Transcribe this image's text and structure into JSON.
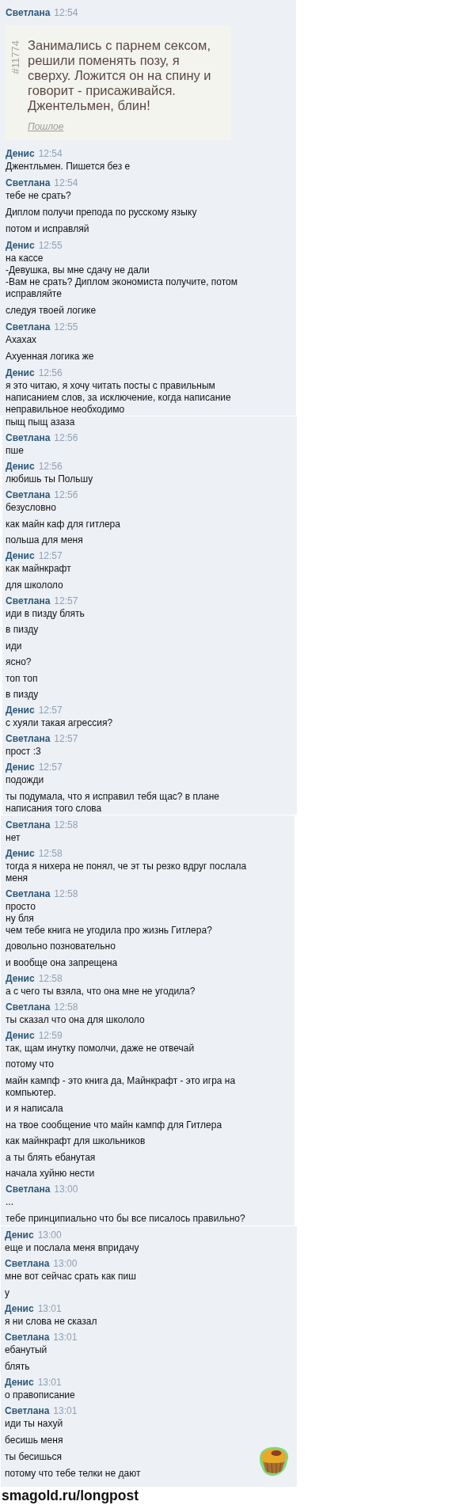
{
  "chat": {
    "segments": [
      {
        "items": [
          {
            "kind": "header",
            "sender": "Светлана",
            "time": "12:54"
          },
          {
            "kind": "quote",
            "number": "#11774",
            "text": "Занимались с парнем сексом,\nрешили поменять позу, я\nсверху. Ложится он на спину и\nговорит - присаживайся.\nДжентельмен, блин!",
            "tag": "Пошлое"
          },
          {
            "kind": "header",
            "sender": "Денис",
            "time": "12:54"
          },
          {
            "kind": "message",
            "text": "Джентльмен. Пишется без е"
          },
          {
            "kind": "header",
            "sender": "Светлана",
            "time": "12:54"
          },
          {
            "kind": "message",
            "text": "тебе не срать?"
          },
          {
            "kind": "message",
            "text": "Диплом получи препода по русскому языку"
          },
          {
            "kind": "message",
            "text": "потом и исправляй"
          },
          {
            "kind": "header",
            "sender": "Денис",
            "time": "12:55"
          },
          {
            "kind": "message",
            "text": "на кассе\n-Девушка, вы мне сдачу не дали\n-Вам не срать? Диплом экономиста получите, потом\nисправляйте"
          },
          {
            "kind": "message",
            "text": "следуя твоей логике"
          },
          {
            "kind": "header",
            "sender": "Светлана",
            "time": "12:55"
          },
          {
            "kind": "message",
            "text": "Ахахах"
          },
          {
            "kind": "message",
            "text": "Ахуенная логика же"
          },
          {
            "kind": "header",
            "sender": "Денис",
            "time": "12:56"
          },
          {
            "kind": "message",
            "text": "я это читаю, я хочу читать посты с правильным\nнаписанием слов, за исключение, когда написание\nнеправильное необходимо"
          }
        ]
      },
      {
        "items": [
          {
            "kind": "message",
            "text": "пыщ пыщ азаза"
          },
          {
            "kind": "header",
            "sender": "Светлана",
            "time": "12:56"
          },
          {
            "kind": "message",
            "text": "пше"
          },
          {
            "kind": "header",
            "sender": "Денис",
            "time": "12:56"
          },
          {
            "kind": "message",
            "text": "любишь ты Польшу"
          },
          {
            "kind": "header",
            "sender": "Светлана",
            "time": "12:56"
          },
          {
            "kind": "message",
            "text": "безусловно"
          },
          {
            "kind": "message",
            "text": "как майн каф для гитлера"
          },
          {
            "kind": "message",
            "text": "польша для меня"
          },
          {
            "kind": "header",
            "sender": "Денис",
            "time": "12:57"
          },
          {
            "kind": "message",
            "text": "как майнкрафт"
          },
          {
            "kind": "message",
            "text": "для школоло"
          },
          {
            "kind": "header",
            "sender": "Светлана",
            "time": "12:57"
          },
          {
            "kind": "message",
            "text": "иди в пизду блять"
          },
          {
            "kind": "message",
            "text": "в пизду"
          },
          {
            "kind": "message",
            "text": "иди"
          },
          {
            "kind": "message",
            "text": "ясно?"
          },
          {
            "kind": "message",
            "text": "топ топ"
          },
          {
            "kind": "message",
            "text": "в пизду"
          },
          {
            "kind": "header",
            "sender": "Денис",
            "time": "12:57"
          },
          {
            "kind": "message",
            "text": "с хуяли такая агрессия?"
          },
          {
            "kind": "header",
            "sender": "Светлана",
            "time": "12:57"
          },
          {
            "kind": "message",
            "text": "прост :3"
          },
          {
            "kind": "header",
            "sender": "Денис",
            "time": "12:57"
          },
          {
            "kind": "message",
            "text": "подожди"
          },
          {
            "kind": "message",
            "text": "ты подумала, что я исправил тебя щас? в плане\nнаписания того слова"
          }
        ]
      },
      {
        "items": [
          {
            "kind": "header",
            "sender": "Светлана",
            "time": "12:58"
          },
          {
            "kind": "message",
            "text": "нет"
          },
          {
            "kind": "header",
            "sender": "Денис",
            "time": "12:58"
          },
          {
            "kind": "message",
            "text": "тогда я нихера не понял, че эт ты резко вдруг послала\nменя"
          },
          {
            "kind": "header",
            "sender": "Светлана",
            "time": "12:58"
          },
          {
            "kind": "message",
            "text": "просто\nну бля\nчем тебе книга не угодила про жизнь Гитлера?"
          },
          {
            "kind": "message",
            "text": "довольно позновательно"
          },
          {
            "kind": "message",
            "text": "и вообще она запрещена"
          },
          {
            "kind": "header",
            "sender": "Денис",
            "time": "12:58"
          },
          {
            "kind": "message",
            "text": "а с чего ты взяла, что она мне не угодила?"
          },
          {
            "kind": "header",
            "sender": "Светлана",
            "time": "12:58"
          },
          {
            "kind": "message",
            "text": "ты сказал что она для школоло"
          },
          {
            "kind": "header",
            "sender": "Денис",
            "time": "12:59"
          },
          {
            "kind": "message",
            "text": "так, щам инутку помолчи, даже не отвечай"
          },
          {
            "kind": "message",
            "text": "потому что"
          },
          {
            "kind": "message",
            "text": "майн кампф - это книга да, Майнкрафт - это игра на\nкомпьютер."
          },
          {
            "kind": "message",
            "text": "и я написала"
          },
          {
            "kind": "message",
            "text": "на твое сообщение что майн кампф для Гитлера"
          },
          {
            "kind": "message",
            "text": "как майнкрафт для школьников"
          },
          {
            "kind": "message",
            "text": "а ты блять ебанутая"
          },
          {
            "kind": "message",
            "text": "начала хуйню нести"
          },
          {
            "kind": "header",
            "sender": "Светлана",
            "time": "13:00"
          },
          {
            "kind": "message",
            "text": "..."
          },
          {
            "kind": "message",
            "text": "тебе принципиально что бы все писалось правильно?"
          }
        ]
      },
      {
        "items": [
          {
            "kind": "header",
            "sender": "Денис",
            "time": "13:00"
          },
          {
            "kind": "message",
            "text": "еще и послала меня впридачу"
          },
          {
            "kind": "header",
            "sender": "Светлана",
            "time": "13:00"
          },
          {
            "kind": "message",
            "text": "мне вот сейчас срать как пиш"
          },
          {
            "kind": "message",
            "text": "у"
          },
          {
            "kind": "header",
            "sender": "Денис",
            "time": "13:01"
          },
          {
            "kind": "message",
            "text": "я ни слова не сказал"
          },
          {
            "kind": "header",
            "sender": "Светлана",
            "time": "13:01"
          },
          {
            "kind": "message",
            "text": "ебанутый"
          },
          {
            "kind": "message",
            "text": "блять"
          },
          {
            "kind": "header",
            "sender": "Денис",
            "time": "13:01"
          },
          {
            "kind": "message",
            "text": "о правописание"
          },
          {
            "kind": "header",
            "sender": "Светлана",
            "time": "13:01"
          },
          {
            "kind": "message",
            "text": "иди ты нахуй"
          },
          {
            "kind": "message",
            "text": "бесишь меня"
          },
          {
            "kind": "message",
            "text": "ты бесишься"
          },
          {
            "kind": "message",
            "text": "потому что тебе телки не дают"
          },
          {
            "kind": "sticker"
          }
        ]
      }
    ]
  },
  "caption": "smagold.ru/longpost"
}
